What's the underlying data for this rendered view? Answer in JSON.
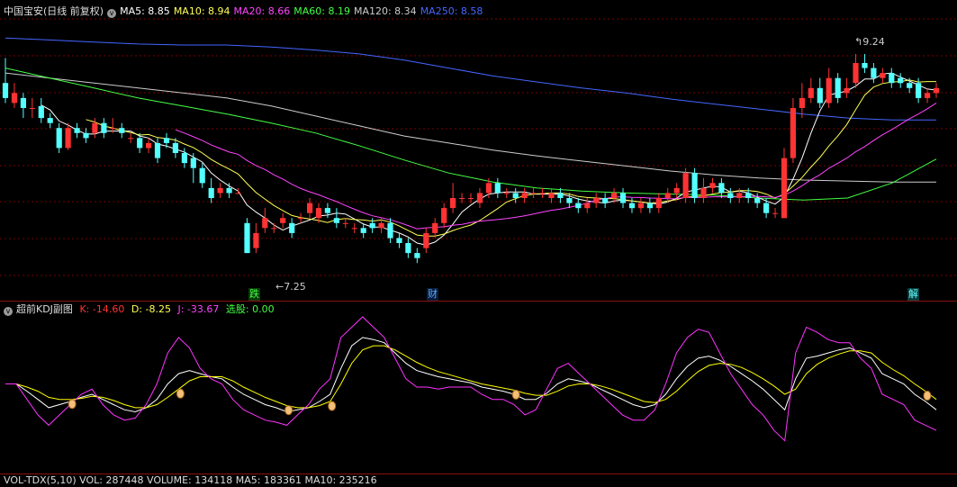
{
  "header": {
    "title": "中国宝安(日线 前复权)",
    "ma": [
      {
        "label": "MA5: 8.85",
        "color": "#ffffff"
      },
      {
        "label": "MA10: 8.94",
        "color": "#ffff55"
      },
      {
        "label": "MA20: 8.66",
        "color": "#ff44ff"
      },
      {
        "label": "MA60: 8.19",
        "color": "#44ff44"
      },
      {
        "label": "MA120: 8.34",
        "color": "#cccccc"
      },
      {
        "label": "MA250: 8.58",
        "color": "#4466ff"
      }
    ]
  },
  "kdj_header": {
    "title": "超前KDJ副图",
    "k": "K: -14.60",
    "d": "D: -8.25",
    "j": "J: -33.67",
    "pick": "选股: 0.00"
  },
  "vol_header": {
    "text": "VOL-TDX(5,10)  VOL: 287448  VOLUME: 134118  MA5: 183361  MA10: 235216"
  },
  "annotations": {
    "high": "9.24",
    "low": "7.25",
    "tag1": "跌",
    "tag2": "财",
    "tag3": "解"
  },
  "colors": {
    "up": "#ff3333",
    "down": "#54ffff",
    "kline": "#ffffff",
    "dline": "#ffff00",
    "jline": "#ff33ff",
    "grid": "#7a0000"
  },
  "chart_data": [
    {
      "type": "candlestick",
      "title": "中国宝安(日线 前复权)",
      "ylim": [
        6.9,
        9.6
      ],
      "candles": [
        [
          8.95,
          8.8,
          9.2,
          8.75
        ],
        [
          8.75,
          8.85,
          8.95,
          8.7
        ],
        [
          8.8,
          8.7,
          8.85,
          8.6
        ],
        [
          8.7,
          8.7,
          8.8,
          8.6
        ],
        [
          8.72,
          8.6,
          8.8,
          8.55
        ],
        [
          8.6,
          8.55,
          8.65,
          8.5
        ],
        [
          8.5,
          8.3,
          8.55,
          8.25
        ],
        [
          8.3,
          8.5,
          8.55,
          8.28
        ],
        [
          8.5,
          8.45,
          8.55,
          8.4
        ],
        [
          8.45,
          8.4,
          8.5,
          8.35
        ],
        [
          8.45,
          8.55,
          8.6,
          8.4
        ],
        [
          8.55,
          8.45,
          8.6,
          8.4
        ],
        [
          8.5,
          8.5,
          8.6,
          8.45
        ],
        [
          8.5,
          8.45,
          8.55,
          8.4
        ],
        [
          8.4,
          8.4,
          8.45,
          8.35
        ],
        [
          8.4,
          8.3,
          8.45,
          8.25
        ],
        [
          8.3,
          8.35,
          8.4,
          8.25
        ],
        [
          8.35,
          8.2,
          8.4,
          8.15
        ],
        [
          8.4,
          8.35,
          8.45,
          8.3
        ],
        [
          8.35,
          8.25,
          8.4,
          8.2
        ],
        [
          8.25,
          8.15,
          8.3,
          8.1
        ],
        [
          8.2,
          8.1,
          8.25,
          7.95
        ],
        [
          8.1,
          7.95,
          8.15,
          7.9
        ],
        [
          7.9,
          7.8,
          8.0,
          7.75
        ],
        [
          7.85,
          7.9,
          7.95,
          7.8
        ],
        [
          7.9,
          7.85,
          7.95,
          7.8
        ],
        [
          7.85,
          7.85,
          7.9,
          7.85
        ],
        [
          7.55,
          7.25,
          7.6,
          7.25
        ],
        [
          7.3,
          7.45,
          7.55,
          7.25
        ],
        [
          7.5,
          7.6,
          7.7,
          7.45
        ],
        [
          7.5,
          7.5,
          7.55,
          7.45
        ],
        [
          7.55,
          7.6,
          7.65,
          7.5
        ],
        [
          7.55,
          7.45,
          7.6,
          7.4
        ],
        [
          7.6,
          7.6,
          7.65,
          7.55
        ],
        [
          7.65,
          7.75,
          7.8,
          7.6
        ],
        [
          7.6,
          7.7,
          7.75,
          7.55
        ],
        [
          7.7,
          7.65,
          7.75,
          7.6
        ],
        [
          7.6,
          7.55,
          7.7,
          7.5
        ],
        [
          7.55,
          7.55,
          7.6,
          7.5
        ],
        [
          7.5,
          7.5,
          7.55,
          7.45
        ],
        [
          7.5,
          7.45,
          7.55,
          7.4
        ],
        [
          7.55,
          7.5,
          7.6,
          7.45
        ],
        [
          7.5,
          7.55,
          7.6,
          7.45
        ],
        [
          7.55,
          7.4,
          7.6,
          7.35
        ],
        [
          7.4,
          7.35,
          7.45,
          7.3
        ],
        [
          7.35,
          7.25,
          7.4,
          7.2
        ],
        [
          7.25,
          7.2,
          7.3,
          7.15
        ],
        [
          7.3,
          7.45,
          7.5,
          7.25
        ],
        [
          7.45,
          7.55,
          7.6,
          7.4
        ],
        [
          7.55,
          7.7,
          7.75,
          7.5
        ],
        [
          7.7,
          7.8,
          7.95,
          7.65
        ],
        [
          7.8,
          7.8,
          7.85,
          7.75
        ],
        [
          7.8,
          7.8,
          7.85,
          7.75
        ],
        [
          7.75,
          7.85,
          7.9,
          7.7
        ],
        [
          7.85,
          7.95,
          8.0,
          7.8
        ],
        [
          7.95,
          7.85,
          8.0,
          7.8
        ],
        [
          7.85,
          7.85,
          7.9,
          7.8
        ],
        [
          7.85,
          7.8,
          7.9,
          7.75
        ],
        [
          7.8,
          7.85,
          7.9,
          7.75
        ],
        [
          7.85,
          7.85,
          7.9,
          7.8
        ],
        [
          7.85,
          7.85,
          7.9,
          7.8
        ],
        [
          7.8,
          7.85,
          7.9,
          7.75
        ],
        [
          7.85,
          7.8,
          7.9,
          7.75
        ],
        [
          7.8,
          7.75,
          7.85,
          7.7
        ],
        [
          7.75,
          7.7,
          7.8,
          7.65
        ],
        [
          7.7,
          7.75,
          7.8,
          7.65
        ],
        [
          7.75,
          7.8,
          7.85,
          7.7
        ],
        [
          7.8,
          7.75,
          7.85,
          7.7
        ],
        [
          7.8,
          7.85,
          7.9,
          7.75
        ],
        [
          7.85,
          7.75,
          7.9,
          7.7
        ],
        [
          7.75,
          7.7,
          7.8,
          7.65
        ],
        [
          7.7,
          7.75,
          7.8,
          7.65
        ],
        [
          7.75,
          7.7,
          7.8,
          7.65
        ],
        [
          7.7,
          7.8,
          7.85,
          7.65
        ],
        [
          7.8,
          7.85,
          7.9,
          7.75
        ],
        [
          7.85,
          7.9,
          7.95,
          7.8
        ],
        [
          7.8,
          8.05,
          8.1,
          7.75
        ],
        [
          8.05,
          7.8,
          8.1,
          7.75
        ],
        [
          7.8,
          7.9,
          8.0,
          7.75
        ],
        [
          7.9,
          7.95,
          8.0,
          7.85
        ],
        [
          7.95,
          7.85,
          8.0,
          7.8
        ],
        [
          7.85,
          7.8,
          7.9,
          7.75
        ],
        [
          7.8,
          7.85,
          7.9,
          7.75
        ],
        [
          7.85,
          7.8,
          7.9,
          7.75
        ],
        [
          7.8,
          7.75,
          7.85,
          7.7
        ],
        [
          7.75,
          7.65,
          7.8,
          7.6
        ],
        [
          7.65,
          7.65,
          7.7,
          7.6
        ],
        [
          7.6,
          8.2,
          8.3,
          7.6
        ],
        [
          8.2,
          8.7,
          8.8,
          8.15
        ],
        [
          8.7,
          8.8,
          8.95,
          8.6
        ],
        [
          8.8,
          8.9,
          9.0,
          8.75
        ],
        [
          8.9,
          8.75,
          9.0,
          8.7
        ],
        [
          8.75,
          9.0,
          9.1,
          8.7
        ],
        [
          9.0,
          8.8,
          9.05,
          8.75
        ],
        [
          8.85,
          8.9,
          9.0,
          8.8
        ],
        [
          8.95,
          9.15,
          9.24,
          8.9
        ],
        [
          9.15,
          9.1,
          9.24,
          9.05
        ],
        [
          9.1,
          9.0,
          9.15,
          8.95
        ],
        [
          9.0,
          9.05,
          9.1,
          8.95
        ],
        [
          9.05,
          8.95,
          9.1,
          8.9
        ],
        [
          9.0,
          8.95,
          9.05,
          8.9
        ],
        [
          8.95,
          8.9,
          9.0,
          8.85
        ],
        [
          8.95,
          8.8,
          9.0,
          8.75
        ],
        [
          8.8,
          8.85,
          8.9,
          8.75
        ],
        [
          8.85,
          8.9,
          8.95,
          8.8
        ]
      ],
      "ma_series": [
        {
          "name": "MA120",
          "values": [
            9.05,
            9.0,
            8.95,
            8.9,
            8.85,
            8.8,
            8.72,
            8.62,
            8.52,
            8.42,
            8.35,
            8.28,
            8.22,
            8.17,
            8.12,
            8.07,
            8.03,
            8.0,
            7.98,
            7.97,
            7.96,
            7.96
          ]
        },
        {
          "name": "MA250",
          "values": [
            9.4,
            9.38,
            9.36,
            9.34,
            9.33,
            9.33,
            9.31,
            9.28,
            9.24,
            9.18,
            9.1,
            9.02,
            8.96,
            8.9,
            8.85,
            8.79,
            8.74,
            8.69,
            8.64,
            8.6,
            8.58,
            8.58
          ]
        },
        {
          "name": "MA60",
          "values": [
            9.1,
            9.0,
            8.9,
            8.8,
            8.72,
            8.64,
            8.55,
            8.45,
            8.32,
            8.18,
            8.05,
            7.96,
            7.9,
            7.87,
            7.85,
            7.84,
            7.83,
            7.8,
            7.78,
            7.8,
            7.95,
            8.19
          ]
        }
      ],
      "annotations": {
        "high": 9.24,
        "low": 7.25
      }
    },
    {
      "type": "line",
      "title": "超前KDJ副图",
      "ylim": [
        -40,
        110
      ],
      "series": [
        {
          "name": "K",
          "values": [
            45,
            45,
            38,
            30,
            22,
            25,
            28,
            32,
            35,
            30,
            25,
            20,
            18,
            22,
            30,
            45,
            55,
            58,
            55,
            52,
            50,
            42,
            35,
            30,
            25,
            22,
            18,
            20,
            22,
            28,
            35,
            60,
            82,
            90,
            88,
            85,
            75,
            65,
            58,
            55,
            52,
            50,
            48,
            46,
            42,
            40,
            38,
            35,
            30,
            30,
            36,
            45,
            50,
            48,
            45,
            40,
            35,
            30,
            25,
            22,
            25,
            35,
            50,
            62,
            70,
            72,
            68,
            62,
            55,
            48,
            40,
            30,
            20,
            50,
            70,
            72,
            75,
            78,
            80,
            75,
            70,
            55,
            50,
            45,
            35,
            28,
            20
          ]
        },
        {
          "name": "D",
          "values": [
            45,
            45,
            42,
            38,
            32,
            30,
            30,
            31,
            33,
            32,
            29,
            25,
            22,
            22,
            25,
            32,
            40,
            48,
            52,
            52,
            52,
            48,
            42,
            37,
            32,
            28,
            24,
            22,
            22,
            24,
            28,
            45,
            65,
            78,
            82,
            82,
            78,
            72,
            66,
            61,
            57,
            54,
            51,
            48,
            45,
            43,
            41,
            39,
            36,
            34,
            34,
            38,
            43,
            45,
            45,
            43,
            40,
            36,
            32,
            28,
            27,
            30,
            38,
            48,
            57,
            63,
            65,
            64,
            61,
            56,
            50,
            43,
            35,
            40,
            55,
            64,
            70,
            74,
            77,
            77,
            75,
            66,
            59,
            53,
            45,
            38,
            30
          ]
        },
        {
          "name": "J",
          "values": [
            45,
            45,
            30,
            15,
            5,
            15,
            25,
            35,
            40,
            25,
            15,
            10,
            12,
            25,
            45,
            75,
            90,
            80,
            60,
            50,
            45,
            30,
            20,
            15,
            10,
            8,
            5,
            15,
            25,
            40,
            50,
            90,
            100,
            110,
            100,
            90,
            70,
            50,
            42,
            42,
            40,
            42,
            42,
            42,
            35,
            30,
            30,
            25,
            15,
            20,
            40,
            60,
            65,
            55,
            45,
            35,
            25,
            15,
            10,
            10,
            20,
            45,
            75,
            90,
            98,
            95,
            75,
            55,
            40,
            25,
            15,
            0,
            -10,
            75,
            100,
            95,
            88,
            85,
            85,
            70,
            60,
            35,
            30,
            25,
            10,
            5,
            0
          ]
        }
      ]
    }
  ]
}
